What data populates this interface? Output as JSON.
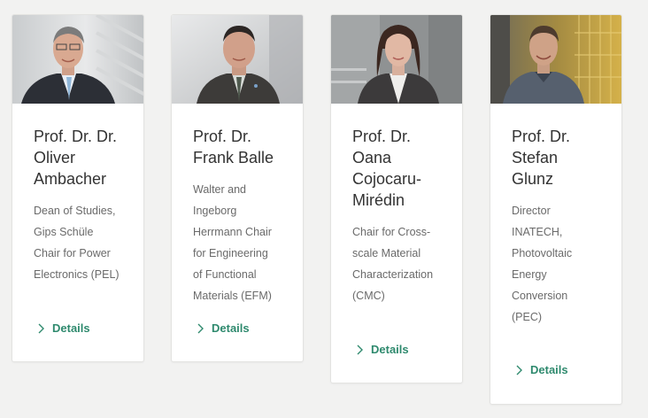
{
  "people": [
    {
      "name_lines": [
        "Prof. Dr. Dr.",
        "Oliver",
        "Ambacher"
      ],
      "role_lines": [
        "Dean of Studies,",
        "Gips Schüle",
        "Chair for Power",
        "Electronics (PEL)"
      ],
      "details_label": "Details"
    },
    {
      "name_lines": [
        "Prof. Dr.",
        "Frank Balle"
      ],
      "role_lines": [
        "Walter and",
        "Ingeborg",
        "Herrmann Chair",
        "for Engineering",
        "of Functional",
        "Materials (EFM)"
      ],
      "details_label": "Details"
    },
    {
      "name_lines": [
        "Prof. Dr.",
        "Oana",
        "Cojocaru-",
        "Mirédin"
      ],
      "role_lines": [
        "Chair for Cross-",
        "scale Material",
        "Characterization",
        "(CMC)"
      ],
      "details_label": "Details"
    },
    {
      "name_lines": [
        "Prof. Dr.",
        "Stefan",
        "Glunz"
      ],
      "role_lines": [
        "Director",
        "INATECH,",
        "Photovoltaic",
        "Energy",
        "Conversion",
        "(PEC)"
      ],
      "details_label": "Details"
    }
  ],
  "colors": {
    "accent": "#2f8a6e",
    "background": "#f2f2f1"
  }
}
